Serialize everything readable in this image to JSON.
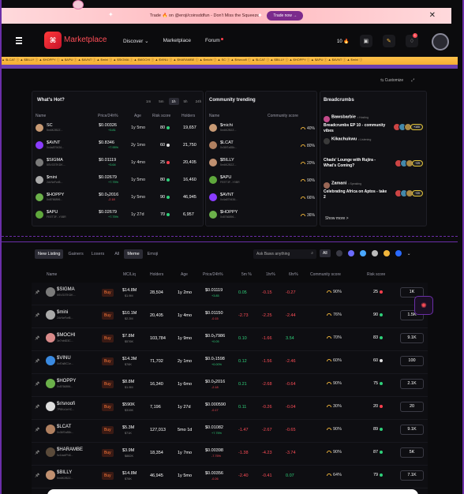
{
  "banner": {
    "text": "Trade 🔥 on @eroji/coinsddfun - Don't Miss the Squeeze",
    "button": "Trade now →"
  },
  "header": {
    "brand": "Marketplace",
    "nav": [
      "Discover",
      "Marketplace",
      "Forum"
    ],
    "count": "10"
  },
  "toolbar": {
    "customize": "Customize"
  },
  "hot": {
    "title": "What's Hot?",
    "tabs": [
      "1m",
      "5m",
      "1h",
      "5h",
      "24h"
    ],
    "active_tab": "1h",
    "headers": [
      "Name",
      "Price/24h%",
      "Age",
      "Risk score",
      "Holders"
    ],
    "rows": [
      {
        "sym": "SC",
        "sub": "5m6K2B2Z...",
        "price": "$0.00326",
        "chg": "+3.81",
        "age": "1y 5mo",
        "risk": "80",
        "risk_color": "#2fd07a",
        "holders": "19,657",
        "color": "#c89a74"
      },
      {
        "sym": "$AVNT",
        "sub": "0x4a879436...",
        "price": "$0.8346",
        "chg": "+7.95%",
        "age": "2y 1mo",
        "risk": "60",
        "risk_color": "#e0e0e0",
        "holders": "21,750",
        "color": "#8a3cff"
      },
      {
        "sym": "$SIGMA",
        "sub": "5SVG3TKDK...",
        "price": "$0.01119",
        "chg": "+3.64",
        "age": "1y 4mo",
        "risk": "25",
        "risk_color": "#ff3f4d",
        "holders": "20,405",
        "color": "#7a7a7a"
      },
      {
        "sym": "$mini",
        "sub": "2ArNeFwf8...",
        "price": "$0.02679",
        "chg": "+7.75%",
        "age": "1y 5mo",
        "risk": "80",
        "risk_color": "#2fd07a",
        "holders": "16,460",
        "color": "#aaa"
      },
      {
        "sym": "$HOPPY",
        "sub": "0x8766896...",
        "price": "$0.0₅2016",
        "chg": "-2.18",
        "age": "1y 5mo",
        "risk": "90",
        "risk_color": "#2fd07a",
        "holders": "46,945",
        "color": "#6bb04a"
      },
      {
        "sym": "$APU",
        "sub": "FEET3F...Y0BR",
        "price": "$0.02679",
        "chg": "+7.75%",
        "age": "1y 27d",
        "risk": "70",
        "risk_color": "#2fd07a",
        "holders": "6,957",
        "color": "#5fa83c"
      }
    ]
  },
  "trend": {
    "title": "Community trending",
    "headers": [
      "Name",
      "Community score"
    ],
    "rows": [
      {
        "sym": "$michi",
        "sub": "5m6K2B2Z...",
        "score": "40%",
        "color": "#c89a74"
      },
      {
        "sym": "$LCAT",
        "sub": "0x36f7a85b...",
        "score": "80%",
        "color": "#b08060"
      },
      {
        "sym": "$BILLY",
        "sub": "5m6K2B2Z...",
        "score": "20%",
        "color": "#c09070"
      },
      {
        "sym": "$APU",
        "sub": "FEET3F...Y0BR",
        "score": "90%",
        "color": "#5fa83c"
      },
      {
        "sym": "$AVNT",
        "sub": "0x4a879436...",
        "score": "66%",
        "color": "#8a3cff"
      },
      {
        "sym": "$HOPPY",
        "sub": "0x8766896...",
        "score": "36%",
        "color": "#6bb04a"
      }
    ]
  },
  "crumbs": {
    "title": "Breadcrumbs",
    "items": [
      {
        "user": "Bawsbarbie",
        "tag": "• Hosting",
        "title": "Breadcrumbs EP 10 - community vibes",
        "count": "+100",
        "color": "#c44a8a"
      },
      {
        "user": "Kikachukwu",
        "tag": "• Listening",
        "title": "",
        "count": "",
        "color": "#3a3a3a"
      },
      {
        "user": "",
        "tag": "",
        "title": "Chads' Lounge with Rujira - What's Coming?",
        "count": "+29",
        "color": "#aa4466"
      },
      {
        "user": "Zamani",
        "tag": "• Speaking",
        "title": "Celebrating Africa on Aptos - take 2",
        "count": "+20",
        "color": "#996655"
      }
    ],
    "show_more": "Show more >"
  },
  "listing": {
    "filters": [
      "New Listing",
      "Gainers",
      "Losers",
      "All",
      "Meme",
      "Emoji"
    ],
    "search_placeholder": "Ask Baws anything",
    "chain_all": "All",
    "headers": [
      "Name",
      "MC/Liq",
      "Holders",
      "Age",
      "Price/24h%",
      "5m %",
      "1hr%",
      "6hr%",
      "Community score",
      "Risk score"
    ],
    "rows": [
      {
        "sym": "$SIGMA",
        "sub": "5SVG3TKDK...",
        "mc": "$14.8M",
        "liq": "$1.9M",
        "holders": "28,504",
        "age": "1y 2mo",
        "price": "$0.01119",
        "pchg": "+3.85",
        "p5": "0.05",
        "p1": "-0.15",
        "p6": "-0.27",
        "cs": "90%",
        "rs": "25",
        "rsc": "#ff3f4d",
        "act": "1K",
        "color": "#7a7a7a"
      },
      {
        "sym": "$mini",
        "sub": "2ArNeFwf8...",
        "mc": "$10.1M",
        "liq": "$2.2M",
        "holders": "20,405",
        "age": "1y 4mo",
        "price": "$0.01150",
        "pchg": "-0.15",
        "p5": "-2.73",
        "p1": "-2.25",
        "p6": "-2.44",
        "cs": "76%",
        "rs": "90",
        "rsc": "#2fd07a",
        "act": "1.5K",
        "color": "#aaa"
      },
      {
        "sym": "$MOCHI",
        "sub": "3e7nbtD3C...",
        "mc": "$7.8M",
        "liq": "$576K",
        "holders": "103,784",
        "age": "1y 9mo",
        "price": "$0.0₅7986",
        "pchg": "+0.05",
        "p5": "0.10",
        "p1": "-1.66",
        "p6": "3.54",
        "cs": "70%",
        "rs": "83",
        "rsc": "#2fd07a",
        "act": "9.1K",
        "color": "#d98a8a"
      },
      {
        "sym": "$VINU",
        "sub": "0xf7a8fC1e...",
        "mc": "$14.3M",
        "liq": "$76K",
        "holders": "71,702",
        "age": "2y 1mo",
        "price": "$0.0₇1598",
        "pchg": "+0.00%",
        "p5": "0.12",
        "p1": "-1.56",
        "p6": "-2.46",
        "cs": "60%",
        "rs": "60",
        "rsc": "#e0e0e0",
        "act": "100",
        "color": "#3a8ae0"
      },
      {
        "sym": "$HOPPY",
        "sub": "0x8766896...",
        "mc": "$8.8M",
        "liq": "$1.9M",
        "holders": "16,340",
        "age": "1y 6mo",
        "price": "$0.0₅2016",
        "pchg": "-2.18",
        "p5": "0.21",
        "p1": "-2.68",
        "p6": "-0.64",
        "cs": "90%",
        "rs": "75",
        "rsc": "#2fd07a",
        "act": "2.1K",
        "color": "#6bb04a"
      },
      {
        "sym": "$r/snoofi",
        "sub": "7P8Kz1nHC...",
        "mc": "$590K",
        "liq": "$315K",
        "holders": "7,196",
        "age": "1y 27d",
        "price": "$0.000590",
        "pchg": "-0.17",
        "p5": "0.11",
        "p1": "-0.26",
        "p6": "-0.04",
        "cs": "30%",
        "rs": "20",
        "rsc": "#ff3f4d",
        "act": "20",
        "color": "#ddd"
      },
      {
        "sym": "$LCAT",
        "sub": "0x36f7a85b...",
        "mc": "$5.3M",
        "liq": "$71K",
        "holders": "127,013",
        "age": "5mo 1d",
        "price": "$0.01082",
        "pchg": "+7.75%",
        "p5": "-1.47",
        "p1": "-2.67",
        "p6": "-0.65",
        "cs": "90%",
        "rs": "89",
        "rsc": "#2fd07a",
        "act": "9.1K",
        "color": "#b08060"
      },
      {
        "sym": "$HARAMBE",
        "sub": "5z1taxtPh8...",
        "mc": "$3.9M",
        "liq": "$882K",
        "holders": "18,354",
        "age": "1y 7mo",
        "price": "$0.00398",
        "pchg": "-7.75%",
        "p5": "-1.38",
        "p1": "-4.23",
        "p6": "-3.74",
        "cs": "90%",
        "rs": "87",
        "rsc": "#2fd07a",
        "act": "5K",
        "color": "#5a4a3a"
      },
      {
        "sym": "$BILLY",
        "sub": "5m6K2B2Z...",
        "mc": "$14.8M",
        "liq": "$76K",
        "holders": "46,945",
        "age": "1y 5mo",
        "price": "$0.00356",
        "pchg": "-0.26",
        "p5": "-2.40",
        "p1": "-0.41",
        "p6": "0.07",
        "cs": "64%",
        "rs": "79",
        "rsc": "#2fd07a",
        "act": "7.1K",
        "color": "#c09070"
      }
    ]
  }
}
